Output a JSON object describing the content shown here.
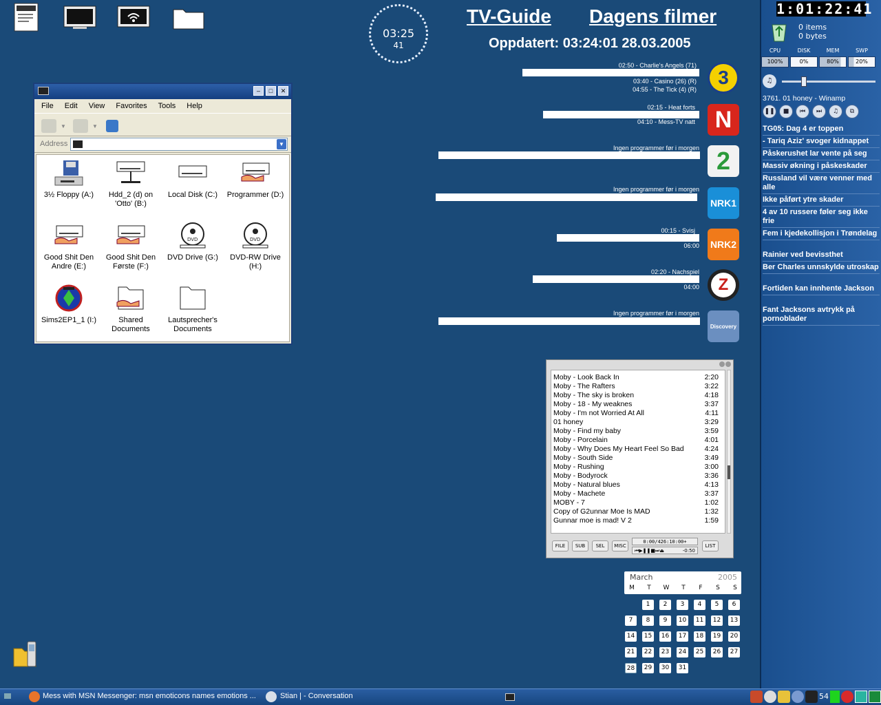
{
  "desktop": {
    "clock": {
      "time": "03:25",
      "seconds": "41"
    },
    "folder_phone_icon": "folder-phone-icon"
  },
  "tvguide": {
    "title": "TV-Guide",
    "movies_title": "Dagens filmer",
    "updated": "Oppdatert: 03:24:01 28.03.2005",
    "channels": [
      {
        "logo": "3",
        "color": "#f4d000",
        "programs": [
          "02:50 - Charlie's Angels (71)",
          "03:40 - Casino (26) (R)",
          "04:55 - The Tick (4) (R)"
        ]
      },
      {
        "logo": "N",
        "color": "#d8261c",
        "programs": [
          "02:15 - Heat forts",
          "04:10 - Mess-TV natt"
        ]
      },
      {
        "logo": "2",
        "color": "#f2f2f2",
        "programs": [
          "Ingen programmer før i morgen"
        ]
      },
      {
        "logo": "NRK1",
        "color": "#1a8fd8",
        "programs": [
          "Ingen programmer før i morgen"
        ]
      },
      {
        "logo": "NRK2",
        "color": "#f07a1a",
        "programs": [
          "00:15 - Svisj",
          "06:00"
        ]
      },
      {
        "logo": "Z",
        "color": "#c8201a",
        "programs": [
          "02:20 - Nachspiel",
          "04:00"
        ]
      },
      {
        "logo": "Discovery",
        "color": "#6b8fc0",
        "programs": [
          "Ingen programmer før i morgen"
        ]
      }
    ]
  },
  "explorer": {
    "menu": [
      "File",
      "Edit",
      "View",
      "Favorites",
      "Tools",
      "Help"
    ],
    "address_label": "Address",
    "items": [
      {
        "label": "3½ Floppy (A:)",
        "icon": "floppy-drive-icon"
      },
      {
        "label": "Hdd_2 (d) on 'Otto' (B:)",
        "icon": "network-drive-icon"
      },
      {
        "label": "Local Disk (C:)",
        "icon": "hard-disk-icon"
      },
      {
        "label": "Programmer (D:)",
        "icon": "shared-disk-icon"
      },
      {
        "label": "Good Shit Den Andre (E:)",
        "icon": "shared-disk-icon"
      },
      {
        "label": "Good Shit Den Første (F:)",
        "icon": "shared-disk-icon"
      },
      {
        "label": "DVD Drive (G:)",
        "icon": "dvd-drive-icon"
      },
      {
        "label": "DVD-RW Drive (H:)",
        "icon": "dvd-drive-icon"
      },
      {
        "label": "Sims2EP1_1 (I:)",
        "icon": "sims-disc-icon"
      },
      {
        "label": "Shared Documents",
        "icon": "shared-folder-icon"
      },
      {
        "label": "Lautsprecher's Documents",
        "icon": "folder-icon"
      }
    ]
  },
  "sidebar": {
    "digital_clock": "1:01:22:41",
    "recycle": {
      "items": "0 items",
      "bytes": "0 bytes"
    },
    "meters": [
      {
        "label": "CPU",
        "value": "100%",
        "fill": 1.0
      },
      {
        "label": "DISK",
        "value": "0%",
        "fill": 0.0
      },
      {
        "label": "MEM",
        "value": "80%",
        "fill": 0.8
      },
      {
        "label": "SWP",
        "value": "20%",
        "fill": 0.2
      }
    ],
    "winamp_title": "3761. 01 honey - Winamp",
    "news": [
      "TG05: Dag 4 er toppen",
      "- Tariq Aziz' svoger kidnappet",
      "Påskerushet lar vente på seg",
      "Massiv økning i påskeskader",
      "Russland vil være venner med alle",
      "Ikke påført ytre skader",
      "4 av 10 russere føler seg ikke frie",
      "Fem i kjedekollisjon i Trøndelag",
      "Rainier ved bevissthet",
      "Ber Charles unnskylde utroskap",
      "Fortiden kan innhente Jackson",
      "Fant Jacksons avtrykk på pornoblader"
    ]
  },
  "playlist": {
    "tracks": [
      {
        "title": "Moby - Look Back In",
        "time": "2:20"
      },
      {
        "title": "Moby - The Rafters",
        "time": "3:22"
      },
      {
        "title": "Moby - The sky is broken",
        "time": "4:18"
      },
      {
        "title": "Moby - 18 - My weaknes",
        "time": "3:37"
      },
      {
        "title": "Moby - I'm not Worried At All",
        "time": "4:11"
      },
      {
        "title": "01 honey",
        "time": "3:29"
      },
      {
        "title": "Moby - Find my baby",
        "time": "3:59"
      },
      {
        "title": "Moby - Porcelain",
        "time": "4:01"
      },
      {
        "title": "Moby - Why Does My Heart Feel So Bad",
        "time": "4:24"
      },
      {
        "title": "Moby - South Side",
        "time": "3:49"
      },
      {
        "title": "Moby - Rushing",
        "time": "3:00"
      },
      {
        "title": "Moby - Bodyrock",
        "time": "3:36"
      },
      {
        "title": "Moby - Natural blues",
        "time": "4:13"
      },
      {
        "title": "Moby - Machete",
        "time": "3:37"
      },
      {
        "title": "MOBY - 7",
        "time": "1:02"
      },
      {
        "title": "Copy of G2unnar Moe Is MAD",
        "time": "1:32"
      },
      {
        "title": "Gunnar moe is mad! V 2",
        "time": "1:59"
      }
    ],
    "buttons": [
      "FILE",
      "SUB",
      "SEL",
      "MISC",
      "LIST"
    ],
    "status": "0:00/426:10:00+",
    "elapsed": "-0:50"
  },
  "calendar": {
    "month": "March",
    "year": "2005",
    "weekdays": [
      "M",
      "T",
      "W",
      "T",
      "F",
      "S",
      "S"
    ],
    "days": [
      "1",
      "2",
      "3",
      "4",
      "5",
      "6",
      "7",
      "8",
      "9",
      "10",
      "11",
      "12",
      "13",
      "14",
      "15",
      "16",
      "17",
      "18",
      "19",
      "20",
      "21",
      "22",
      "23",
      "24",
      "25",
      "26",
      "27",
      "28",
      "29",
      "30",
      "31"
    ]
  },
  "taskbar": {
    "items": [
      "Mess with MSN Messenger: msn emoticons names emotions ...",
      "Stian | - Conversation"
    ],
    "tray_number": "54"
  }
}
